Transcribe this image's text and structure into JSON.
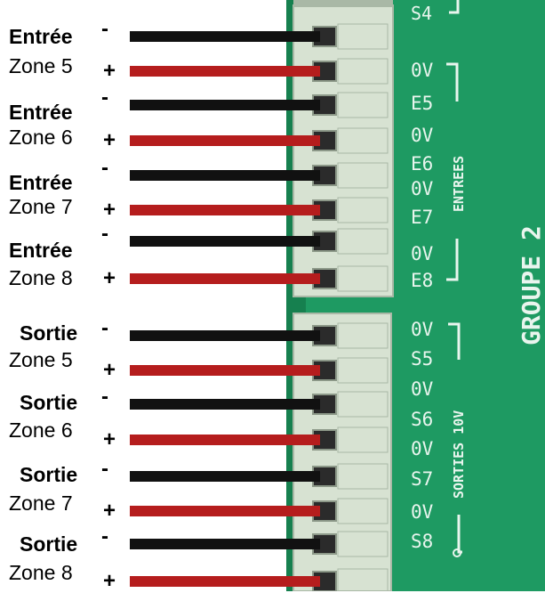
{
  "colors": {
    "board": "#1e9a62",
    "board_dark": "#16804f",
    "board_print": "#e9f5ee",
    "connector": "#d7e2d2",
    "connector_shadow": "#a9b8a6",
    "wire_negative": "#111111",
    "wire_positive": "#b51d1d",
    "text": "#000000"
  },
  "terminals": [
    {
      "title": "Entrée",
      "zone": "Zone 5",
      "neg": "-",
      "pos": "+"
    },
    {
      "title": "Entrée",
      "zone": "Zone 6",
      "neg": "-",
      "pos": "+"
    },
    {
      "title": "Entrée",
      "zone": "Zone 7",
      "neg": "-",
      "pos": "+"
    },
    {
      "title": "Entrée",
      "zone": "Zone 8",
      "neg": "-",
      "pos": "+"
    },
    {
      "title": "Sortie",
      "zone": "Zone 5",
      "neg": "-",
      "pos": "+"
    },
    {
      "title": "Sortie",
      "zone": "Zone 6",
      "neg": "-",
      "pos": "+"
    },
    {
      "title": "Sortie",
      "zone": "Zone 7",
      "neg": "-",
      "pos": "+"
    },
    {
      "title": "Sortie",
      "zone": "Zone 8",
      "neg": "-",
      "pos": "+"
    }
  ],
  "board": {
    "top_pin": "S4",
    "group_label": "GROUPE 2",
    "inputs_label": "ENTREES",
    "outputs_label": "SORTIES 10V",
    "input_pins": [
      "0V",
      "E5",
      "0V",
      "E6",
      "0V",
      "E7",
      "0V",
      "E8"
    ],
    "output_pins": [
      "0V",
      "S5",
      "0V",
      "S6",
      "0V",
      "S7",
      "0V",
      "S8"
    ]
  }
}
